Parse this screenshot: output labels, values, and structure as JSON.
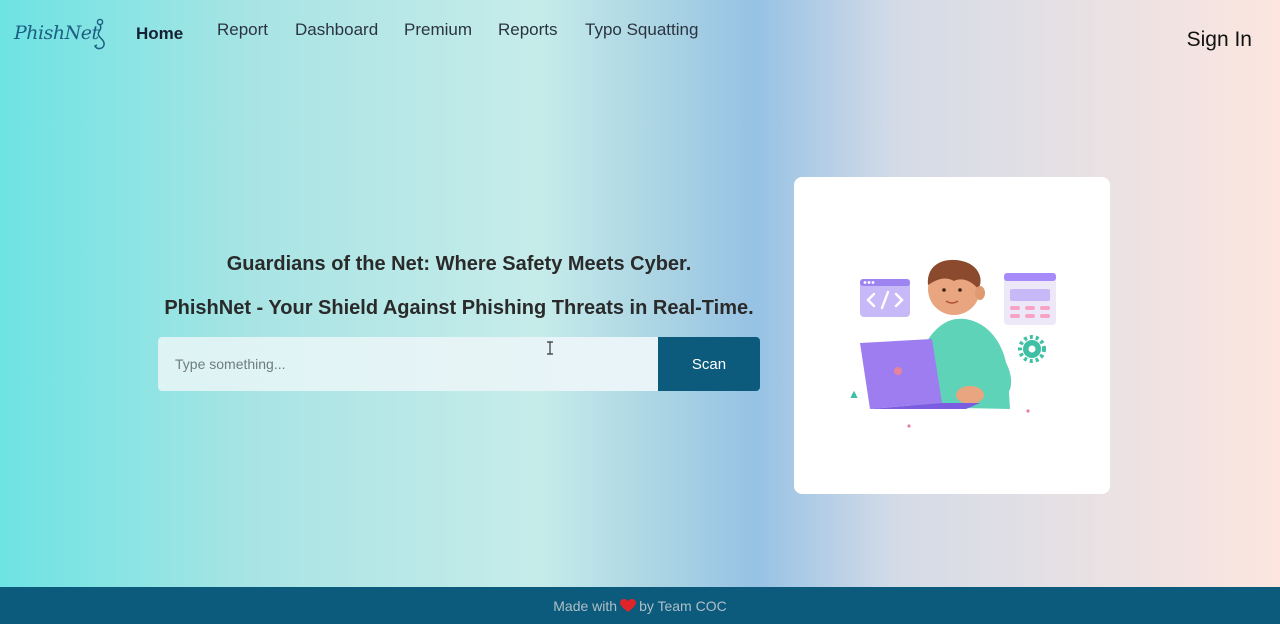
{
  "brand": {
    "logo_text": "PhishNet"
  },
  "nav": {
    "items": [
      {
        "label": "Home",
        "active": true
      },
      {
        "label": "Report",
        "active": false
      },
      {
        "label": "Dashboard",
        "active": false
      },
      {
        "label": "Premium",
        "active": false
      },
      {
        "label": "Reports",
        "active": false
      },
      {
        "label": "Typo Squatting",
        "active": false
      }
    ],
    "sign_in": "Sign In"
  },
  "hero": {
    "tagline": "Guardians of the Net: Where Safety Meets Cyber.",
    "subtitle": "PhishNet - Your Shield Against Phishing Threats in Real-Time.",
    "search": {
      "placeholder": "Type something...",
      "value": ""
    },
    "scan_label": "Scan"
  },
  "illustration": {
    "description_icons": [
      "code-window-icon",
      "person-laptop-icon",
      "calendar-window-icon",
      "gear-icon"
    ]
  },
  "footer": {
    "text_before": "Made with",
    "text_after": "by Team COC",
    "heart_icon": "heart-icon"
  },
  "colors": {
    "primary": "#0c5b7d",
    "heart": "#e0242a",
    "accent_purple": "#a78bfa"
  }
}
